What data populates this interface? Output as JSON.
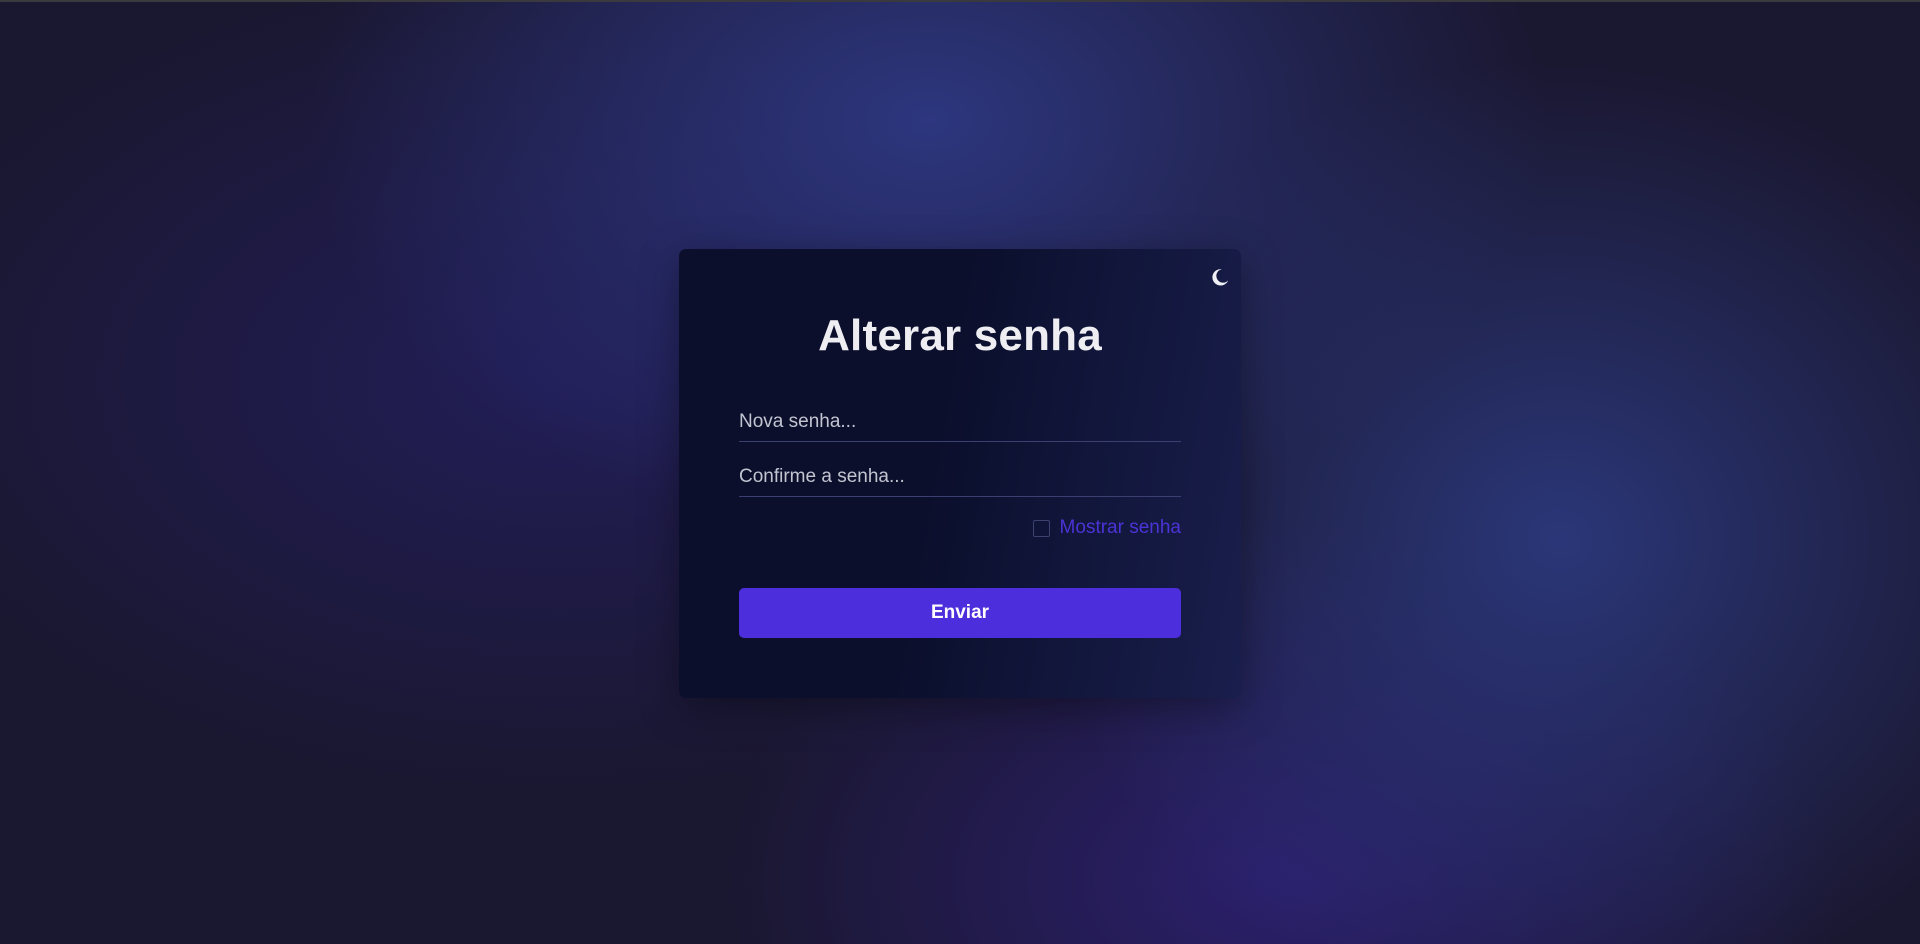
{
  "page": {
    "title": "Alterar senha"
  },
  "form": {
    "new_password_placeholder": "Nova senha...",
    "confirm_password_placeholder": "Confirme a senha...",
    "show_password_label": "Mostrar senha",
    "show_password_checked": false,
    "submit_label": "Enviar"
  },
  "theme_toggle": {
    "icon": "moon-icon"
  },
  "colors": {
    "accent": "#4c2edc",
    "link": "#4b33d6",
    "card_background": "#0b0f2c",
    "page_background": "#1a1730",
    "title_text": "#eeeef2"
  }
}
